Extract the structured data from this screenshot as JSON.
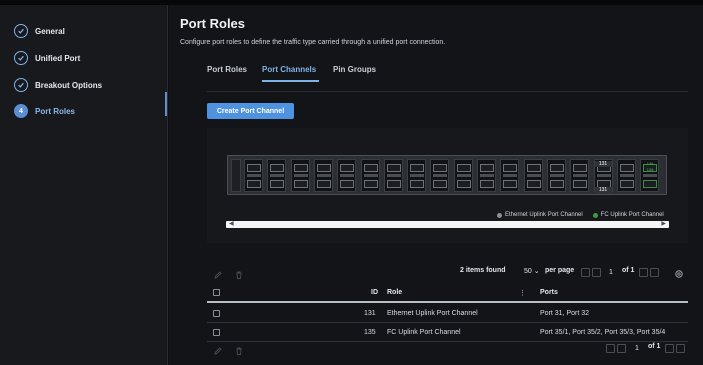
{
  "sidebar": {
    "steps": [
      {
        "label": "General",
        "state": "done"
      },
      {
        "label": "Unified Port",
        "state": "done"
      },
      {
        "label": "Breakout Options",
        "state": "done"
      },
      {
        "label": "Port Roles",
        "state": "active",
        "number": "4"
      }
    ]
  },
  "header": {
    "title": "Port Roles",
    "subtitle": "Configure port roles to define the traffic type carried through a unified port connection."
  },
  "tabs": [
    {
      "label": "Port Roles",
      "active": false
    },
    {
      "label": "Port Channels",
      "active": true
    },
    {
      "label": "Pin Groups",
      "active": false
    }
  ],
  "create_button": "Create Port Channel",
  "diagram": {
    "labels": {
      "port_131": "131",
      "fc_tags": [
        "136",
        "136"
      ]
    },
    "legend": [
      {
        "label": "Ethernet Uplink Port Channel",
        "color": "#8b8f96"
      },
      {
        "label": "FC Uplink Port Channel",
        "color": "#3e9a48"
      }
    ]
  },
  "toolbar": {
    "items_found": "2 items found",
    "per_page_value": "50",
    "per_page_label": "per page",
    "page": "1",
    "of_label": "of 1"
  },
  "table": {
    "columns": {
      "id": "ID",
      "role": "Role",
      "ports": "Ports"
    },
    "rows": [
      {
        "id": "131",
        "role": "Ethernet Uplink Port Channel",
        "ports": "Port 31, Port 32"
      },
      {
        "id": "135",
        "role": "FC Uplink Port Channel",
        "ports": "Port 35/1, Port 35/2, Port 35/3, Port 35/4"
      }
    ]
  },
  "footer": {
    "page": "1",
    "of_label": "of 1"
  },
  "colors": {
    "accent": "#4f93e0",
    "background": "#121418",
    "sidebar": "#17191d"
  }
}
